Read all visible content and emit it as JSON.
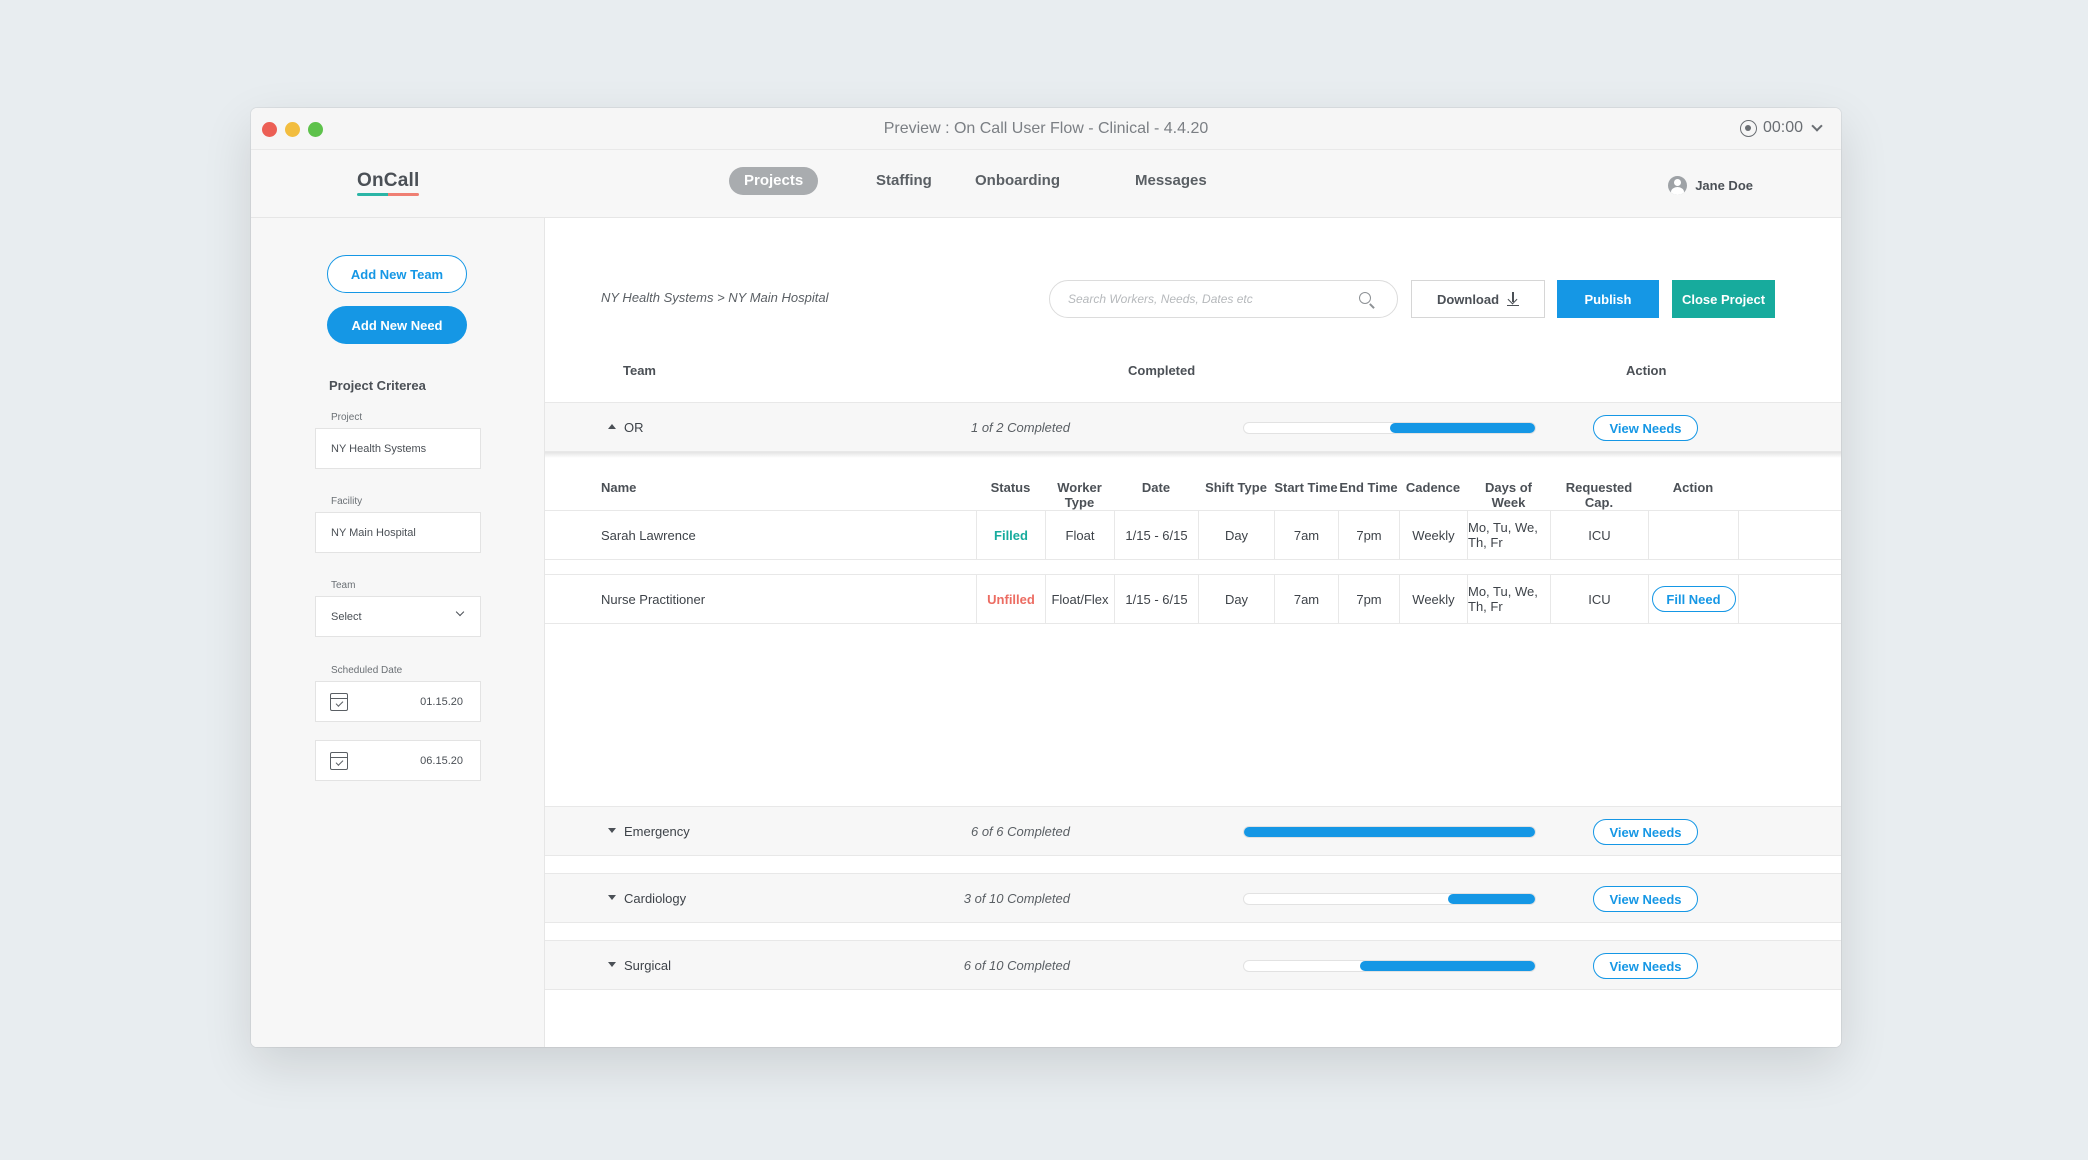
{
  "window": {
    "title": "Preview : On Call User Flow - Clinical - 4.4.20",
    "timer": "00:00"
  },
  "nav": {
    "logo": "OnCall",
    "items": [
      {
        "label": "Projects",
        "active": true
      },
      {
        "label": "Staffing",
        "active": false
      },
      {
        "label": "Onboarding",
        "active": false
      },
      {
        "label": "Messages",
        "active": false
      }
    ],
    "user": "Jane Doe"
  },
  "sidebar": {
    "add_team": "Add New Team",
    "add_need": "Add New Need",
    "criteria_title": "Project Criterea",
    "project_label": "Project",
    "project_value": "NY Health Systems",
    "facility_label": "Facility",
    "facility_value": "NY Main Hospital",
    "team_label": "Team",
    "team_value": "Select",
    "date_label": "Scheduled Date",
    "start_date": "01.15.20",
    "end_date": "06.15.20"
  },
  "toolbar": {
    "breadcrumb": "NY Health Systems > NY Main Hospital",
    "search_placeholder": "Search Workers, Needs, Dates etc",
    "download": "Download",
    "publish": "Publish",
    "close": "Close Project"
  },
  "table": {
    "headers": {
      "team": "Team",
      "completed": "Completed",
      "action": "Action"
    },
    "view_label": "View Needs",
    "sections": [
      {
        "name": "OR",
        "completed": "1 of 2 Completed",
        "progress": 0.5,
        "expanded": true
      },
      {
        "name": "Emergency",
        "completed": "6 of 6 Completed",
        "progress": 1.0,
        "expanded": false
      },
      {
        "name": "Cardiology",
        "completed": "3 of 10 Completed",
        "progress": 0.3,
        "expanded": false
      },
      {
        "name": "Surgical",
        "completed": "6 of 10 Completed",
        "progress": 0.6,
        "expanded": false
      }
    ]
  },
  "needs": {
    "headers": [
      "Name",
      "Status",
      "Worker Type",
      "Date",
      "Shift Type",
      "Start Time",
      "End Time",
      "Cadence",
      "Days of Week",
      "Requested Cap.",
      "Action"
    ],
    "rows": [
      {
        "name": "Sarah Lawrence",
        "status": "Filled",
        "worker_type": "Float",
        "date": "1/15 - 6/15",
        "shift": "Day",
        "start": "7am",
        "end": "7pm",
        "cadence": "Weekly",
        "days": "Mo, Tu, We, Th, Fr",
        "cap": "ICU",
        "action": ""
      },
      {
        "name": "Nurse Practitioner",
        "status": "Unfilled",
        "worker_type": "Float/Flex",
        "date": "1/15 - 6/15",
        "shift": "Day",
        "start": "7am",
        "end": "7pm",
        "cadence": "Weekly",
        "days": "Mo, Tu, We, Th, Fr",
        "cap": "ICU",
        "action": "Fill Need"
      }
    ]
  },
  "colors": {
    "primary": "#1597e5",
    "teal": "#17ab9d",
    "unfilled": "#ec6c62"
  }
}
